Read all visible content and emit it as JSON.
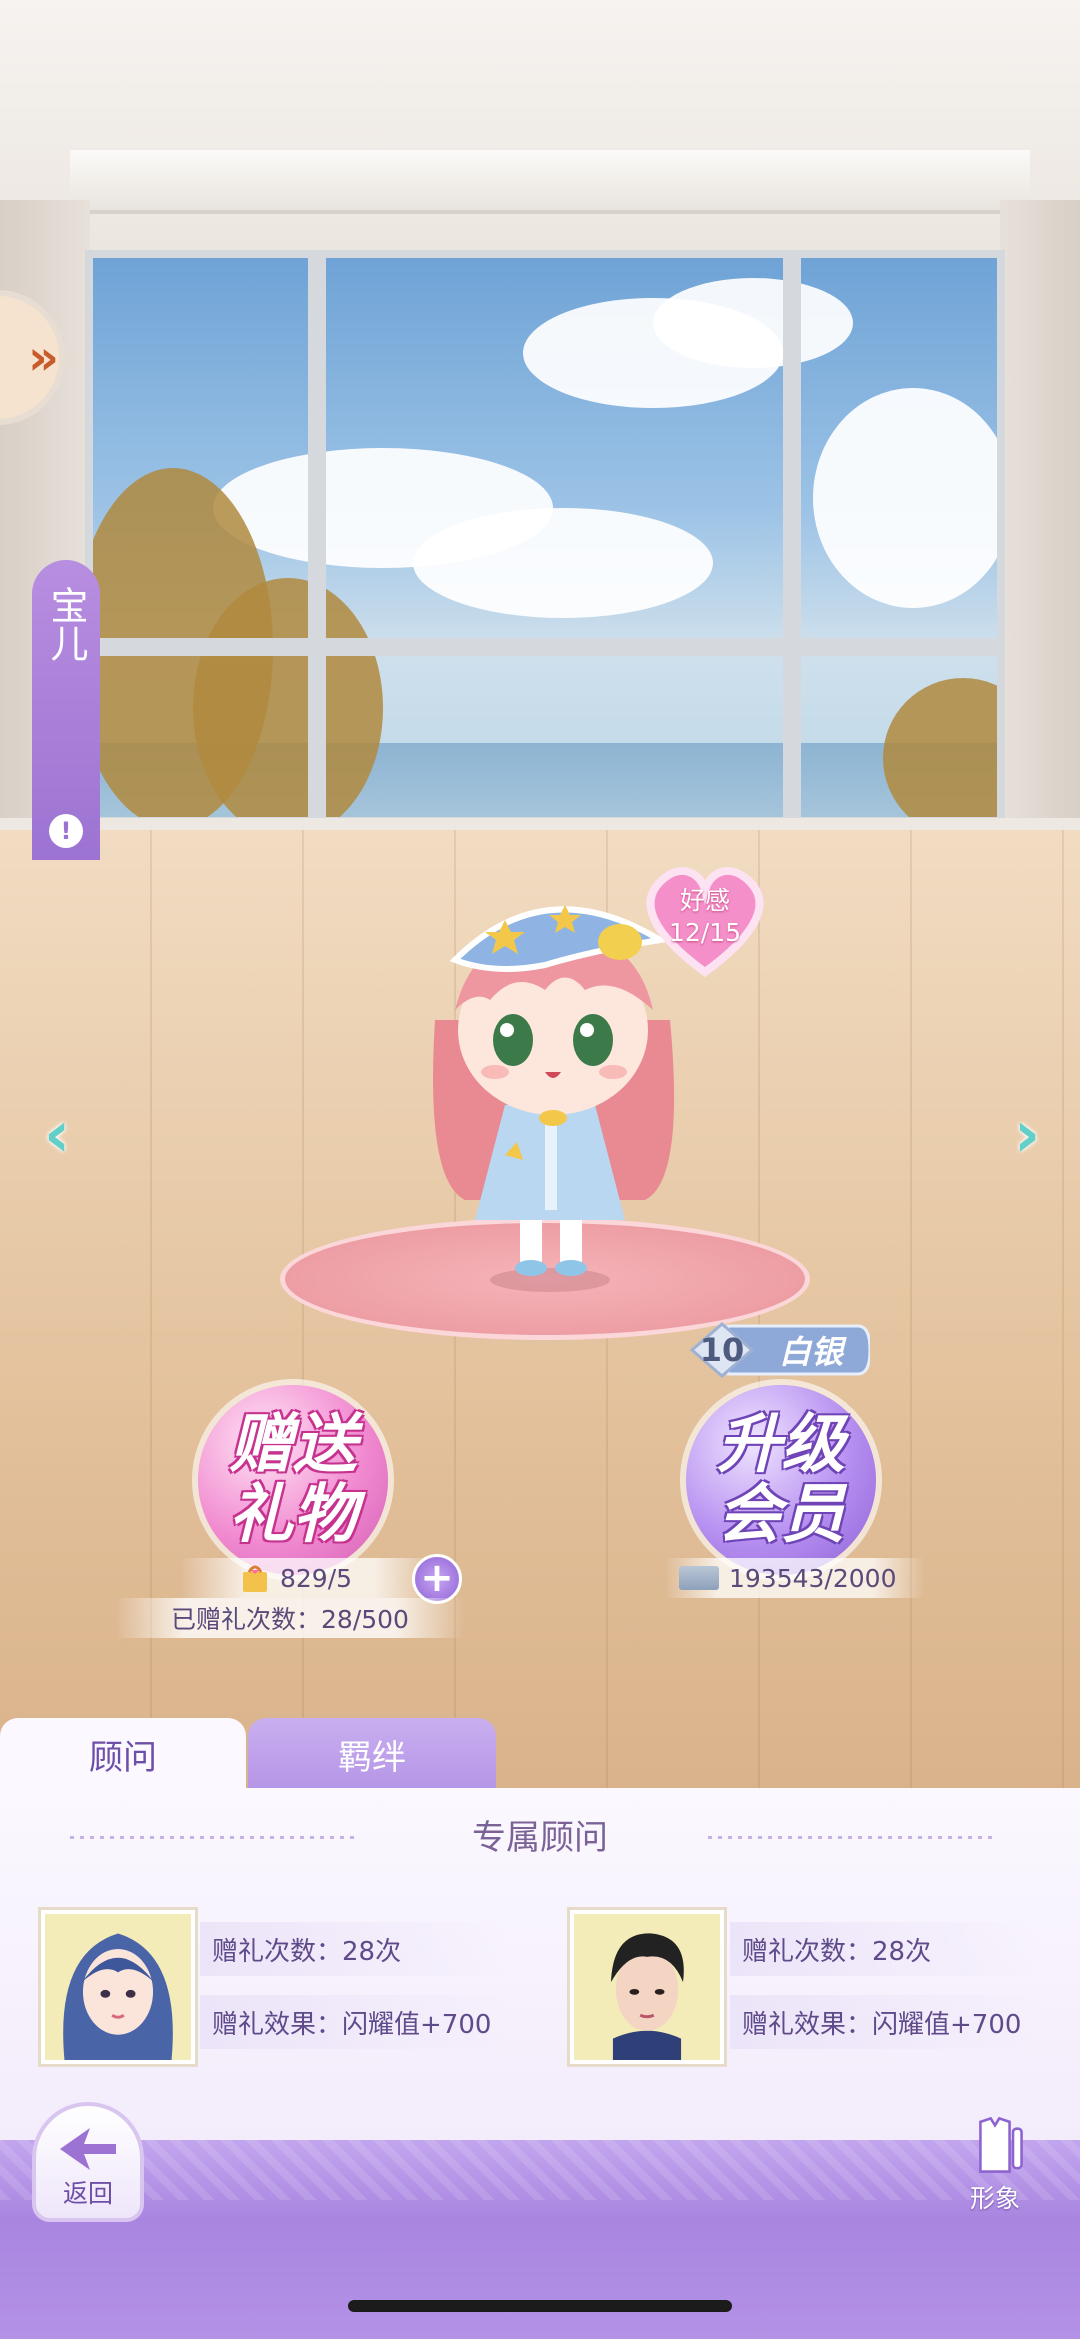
{
  "side": {
    "character_name": "宝儿",
    "alert_glyph": "!",
    "expand_glyph": "»"
  },
  "nav": {
    "prev_glyph": "‹",
    "next_glyph": "›"
  },
  "affection": {
    "label": "好感",
    "value": "12/15"
  },
  "gift": {
    "bubble_line1": "赠送",
    "bubble_line2": "礼物",
    "count": "829/5",
    "given_label": "已赠礼次数：28/500",
    "plus_glyph": "+"
  },
  "membership": {
    "bubble_line1": "升级",
    "bubble_line2": "会员",
    "rank_level": "10",
    "rank_name": "白银",
    "points": "193543/2000"
  },
  "tabs": {
    "active": "顾问",
    "inactive": "羁绊"
  },
  "section": {
    "title": "专属顾问"
  },
  "advisors": [
    {
      "gift_count": "赠礼次数：28次",
      "gift_effect": "赠礼效果：闪耀值+700"
    },
    {
      "gift_count": "赠礼次数：28次",
      "gift_effect": "赠礼效果：闪耀值+700"
    }
  ],
  "footer": {
    "back_label": "返回",
    "image_label": "形象"
  },
  "colors": {
    "accent_purple": "#9c73d2",
    "pink": "#f18ad0",
    "teal_arrow": "#63cfc9"
  }
}
